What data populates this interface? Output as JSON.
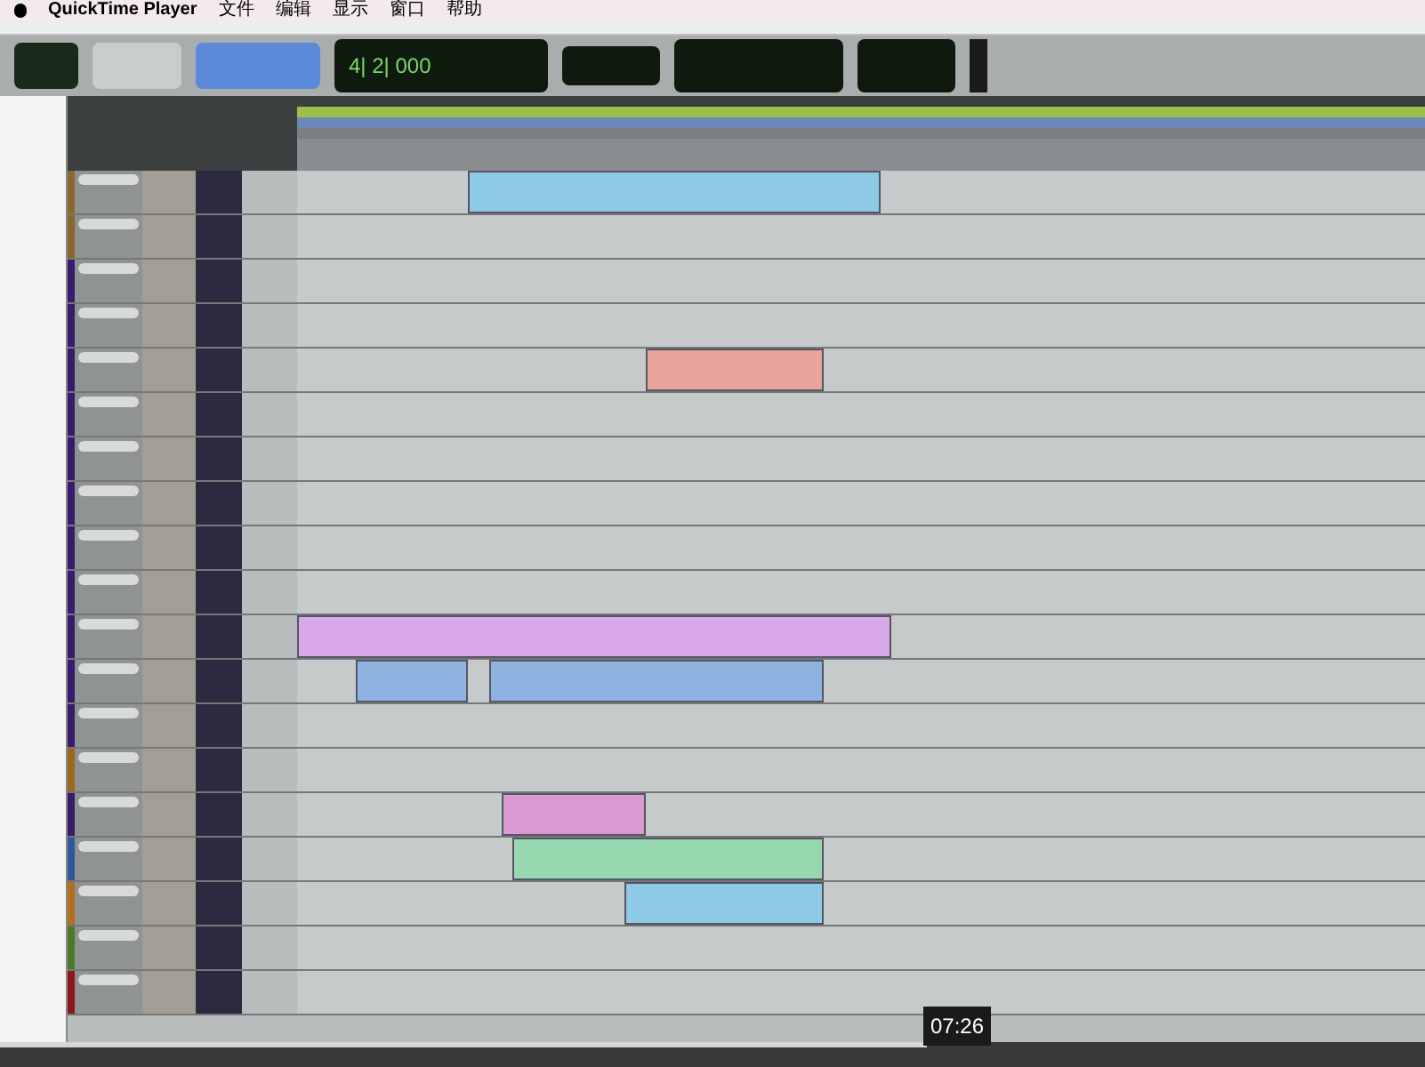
{
  "menu_bar": {
    "app": "QuickTime Player",
    "items": [
      "文件",
      "编辑",
      "显示",
      "窗口",
      "帮助"
    ]
  },
  "counter": {
    "main": "4| 2| 000"
  },
  "tracks": [
    {
      "color": "#8a6a2a",
      "clips": [
        {
          "color": "#8ecae6"
        }
      ]
    },
    {
      "color": "#8a6a2a"
    },
    {
      "color": "#3a1a6a"
    },
    {
      "color": "#3a1a6a"
    },
    {
      "color": "#3a1a6a",
      "clips": [
        {
          "color": "#e8a49a"
        }
      ]
    },
    {
      "color": "#3a1a6a"
    },
    {
      "color": "#3a1a6a"
    },
    {
      "color": "#3a1a6a"
    },
    {
      "color": "#3a1a6a"
    },
    {
      "color": "#3a1a6a"
    },
    {
      "color": "#3a1a6a",
      "clips": [
        {
          "color": "#d8a8e8"
        }
      ]
    },
    {
      "color": "#3a1a6a",
      "clips": [
        {
          "color": "#8fb3e0"
        },
        {
          "color": "#8fb3e0"
        }
      ]
    },
    {
      "color": "#3a1a6a"
    },
    {
      "color": "#9a6a1a"
    },
    {
      "color": "#3a1a6a",
      "clips": [
        {
          "color": "#d89ad0"
        }
      ]
    },
    {
      "color": "#2a5a9a",
      "clips": [
        {
          "color": "#98d8b0"
        }
      ]
    },
    {
      "color": "#b07020",
      "clips": [
        {
          "color": "#8ecae6"
        }
      ]
    },
    {
      "color": "#4a7a2a"
    },
    {
      "color": "#8a1a1a"
    }
  ],
  "player": {
    "time_tooltip": "07:26",
    "level": 0.65
  }
}
